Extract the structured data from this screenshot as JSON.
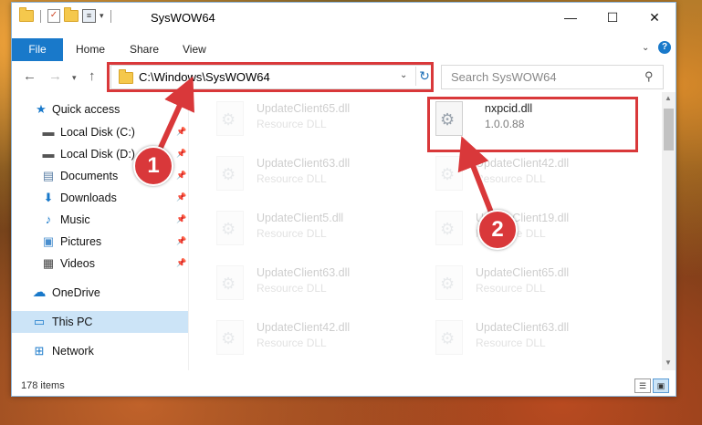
{
  "window": {
    "title": "SysWOW64",
    "minimize": "—",
    "maximize": "☐",
    "close": "✕"
  },
  "ribbon": {
    "tabs": [
      "File",
      "Home",
      "Share",
      "View"
    ],
    "help": "?"
  },
  "address": {
    "path": "C:\\Windows\\SysWOW64",
    "search_placeholder": "Search SysWOW64"
  },
  "sidebar": {
    "items": [
      {
        "label": "Quick access",
        "icon": "star-icon",
        "pinned": false
      },
      {
        "label": "Local Disk (C:)",
        "icon": "drive-icon",
        "pinned": true
      },
      {
        "label": "Local Disk (D:)",
        "icon": "drive-icon",
        "pinned": true
      },
      {
        "label": "Documents",
        "icon": "documents-icon",
        "pinned": true
      },
      {
        "label": "Downloads",
        "icon": "download-icon",
        "pinned": true
      },
      {
        "label": "Music",
        "icon": "music-icon",
        "pinned": true
      },
      {
        "label": "Pictures",
        "icon": "pictures-icon",
        "pinned": true
      },
      {
        "label": "Videos",
        "icon": "videos-icon",
        "pinned": true
      },
      {
        "label": "OneDrive",
        "icon": "cloud-icon",
        "pinned": false
      },
      {
        "label": "This PC",
        "icon": "computer-icon",
        "pinned": false,
        "selected": true
      },
      {
        "label": "Network",
        "icon": "network-icon",
        "pinned": false
      }
    ]
  },
  "files": {
    "left": [
      {
        "name": "UpdateClient65.dll",
        "desc": "Resource DLL"
      },
      {
        "name": "UpdateClient63.dll",
        "desc": "Resource DLL"
      },
      {
        "name": "UpdateClient5.dll",
        "desc": "Resource DLL"
      },
      {
        "name": "UpdateClient63.dll",
        "desc": "Resource DLL"
      },
      {
        "name": "UpdateClient42.dll",
        "desc": "Resource DLL"
      }
    ],
    "right": [
      {
        "name": "nxpcid.dll",
        "desc": "1.0.0.88"
      },
      {
        "name": "UpdateClient42.dll",
        "desc": "Resource DLL"
      },
      {
        "name": "UpdateClient19.dll",
        "desc": "Resource DLL"
      },
      {
        "name": "UpdateClient65.dll",
        "desc": "Resource DLL"
      },
      {
        "name": "UpdateClient63.dll",
        "desc": "Resource DLL"
      }
    ]
  },
  "status": {
    "item_count": "178 items"
  },
  "callouts": [
    "1",
    "2"
  ],
  "colors": {
    "accent": "#1979ca",
    "highlight_red": "#d9383a",
    "selection": "#cce4f7"
  }
}
